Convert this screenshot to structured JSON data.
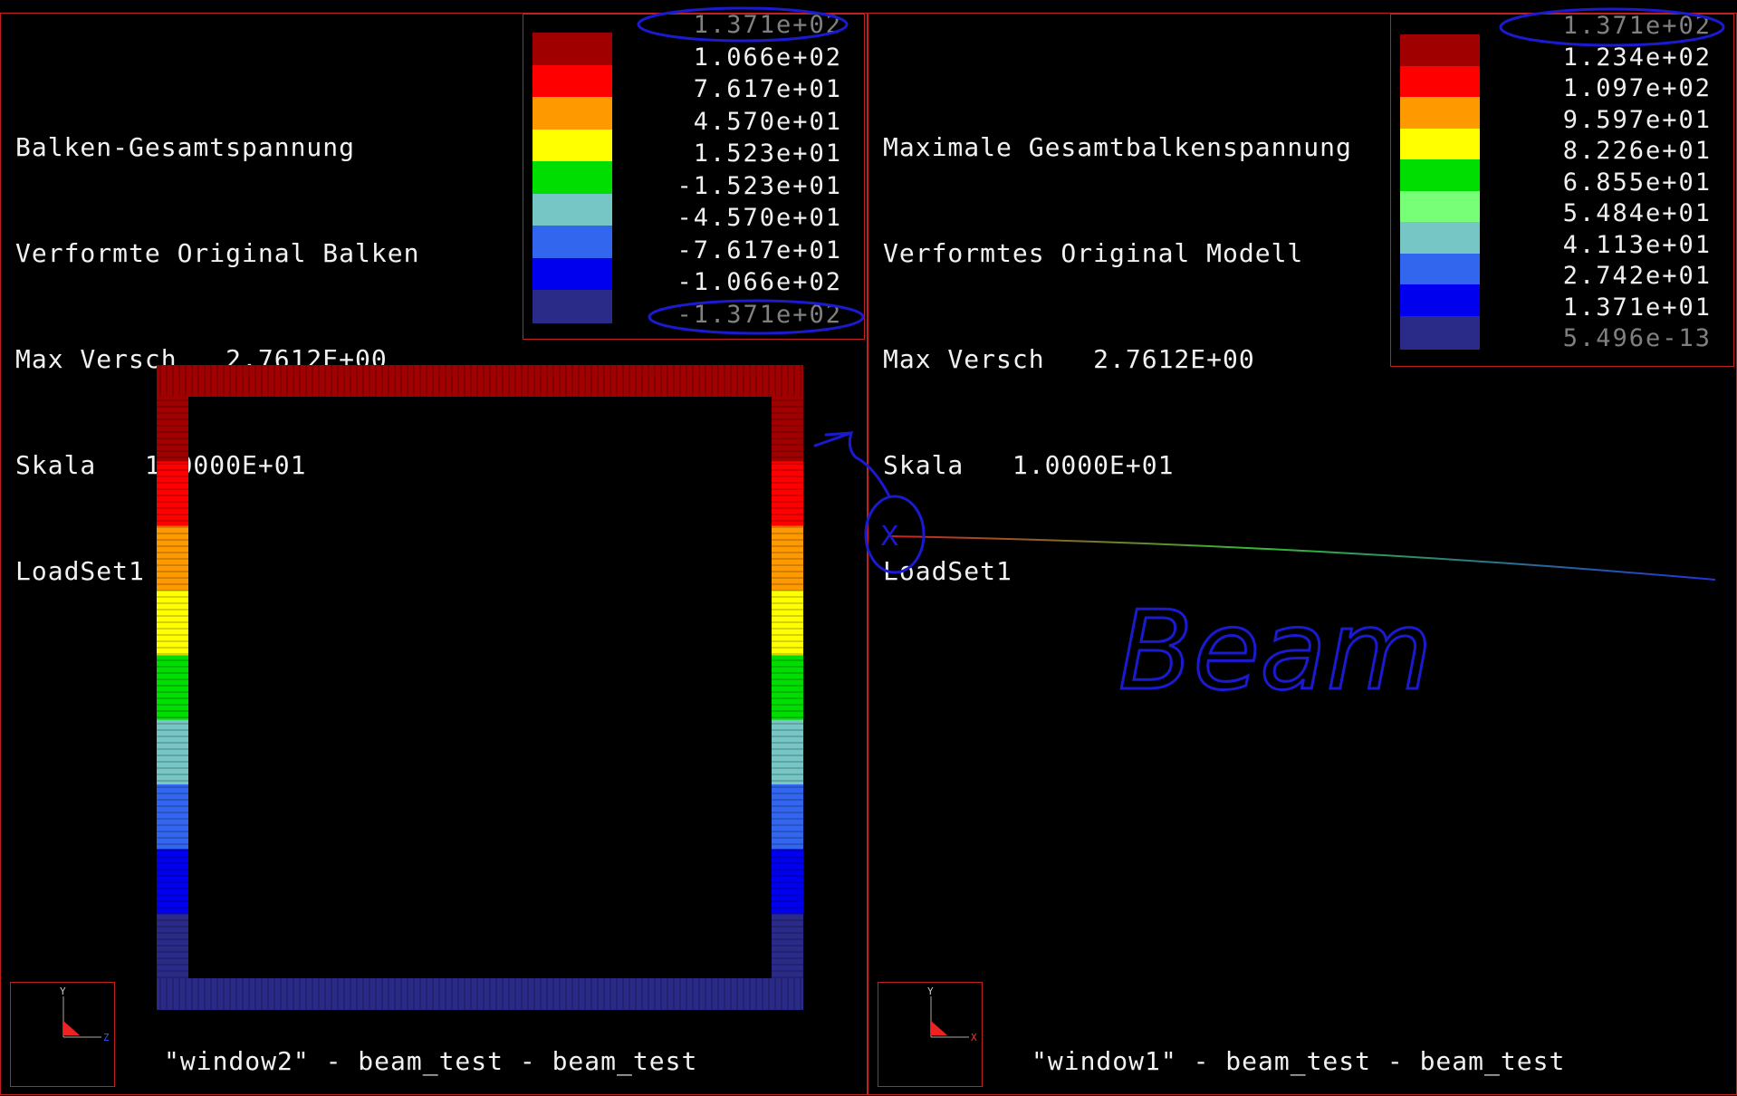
{
  "left_window": {
    "title_lines": [
      "Balken-Gesamtspannung",
      "Verformte Original Balken",
      "Max Versch   2.7612E+00",
      "Skala   1.0000E+01",
      "LoadSet1"
    ],
    "legend": {
      "values": [
        "1.371e+02",
        "1.066e+02",
        "7.617e+01",
        "4.570e+01",
        "1.523e+01",
        "-1.523e+01",
        "-4.570e+01",
        "-7.617e+01",
        "-1.066e+02",
        "-1.371e+02"
      ],
      "colors": [
        "#a00000",
        "#ff0000",
        "#ff9900",
        "#ffff00",
        "#00dd00",
        "#77c6c6",
        "#3366ee",
        "#0000ee",
        "#2a2a88"
      ]
    },
    "caption": "\"window2\" - beam_test - beam_test",
    "triad_axes": [
      "Y",
      "Z"
    ]
  },
  "right_window": {
    "title_lines": [
      "Maximale Gesamtbalkenspannung",
      "Verformtes Original Modell",
      "Max Versch   2.7612E+00",
      "Skala   1.0000E+01",
      "LoadSet1"
    ],
    "legend": {
      "values": [
        "1.371e+02",
        "1.234e+02",
        "1.097e+02",
        "9.597e+01",
        "8.226e+01",
        "6.855e+01",
        "5.484e+01",
        "4.113e+01",
        "2.742e+01",
        "1.371e+01",
        "5.496e-13"
      ],
      "colors": [
        "#a00000",
        "#ff0000",
        "#ff9900",
        "#ffff00",
        "#00dd00",
        "#77ff77",
        "#77c6c6",
        "#3366ee",
        "#0000ee",
        "#2a2a88"
      ]
    },
    "caption": "\"window1\" - beam_test - beam_test",
    "triad_axes": [
      "Y",
      "X"
    ]
  },
  "annotation": {
    "handwritten": "Beam",
    "marker": "X"
  },
  "beam_section": {
    "band_colors": [
      "#a00000",
      "#ff0000",
      "#ff9900",
      "#ffff00",
      "#00dd00",
      "#77c6c6",
      "#3366ee",
      "#0000ee",
      "#2a2a88"
    ]
  }
}
